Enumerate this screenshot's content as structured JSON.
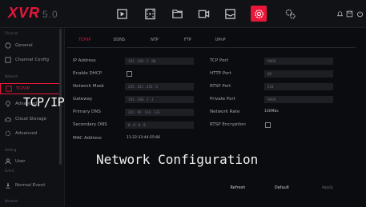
{
  "app": {
    "logo": "XVR",
    "version": "5.0"
  },
  "top_nav": [
    {
      "icon": "playback-icon",
      "active": false
    },
    {
      "icon": "film-icon",
      "active": false
    },
    {
      "icon": "folder-icon",
      "active": false
    },
    {
      "icon": "camera-icon",
      "active": false
    },
    {
      "icon": "storage-icon",
      "active": false
    },
    {
      "icon": "settings-gear-icon",
      "active": true
    },
    {
      "icon": "network-icon",
      "active": false
    }
  ],
  "top_right_icons": [
    "bell-icon",
    "save-icon",
    "power-icon"
  ],
  "sidebar": {
    "groups": {
      "channel": "Channel",
      "network": "Network",
      "setting": "Setting",
      "event": "Event",
      "system": "Network"
    },
    "items": [
      {
        "label": "General",
        "icon": "general-icon"
      },
      {
        "label": "Channel Config",
        "icon": "channel-icon"
      },
      {
        "label": "TCP/IP",
        "icon": "tcpip-icon"
      },
      {
        "label": "Advanced",
        "icon": "advanced-icon"
      },
      {
        "label": "Cloud Storage",
        "icon": "cloud-icon"
      },
      {
        "label": "Advanced",
        "icon": "advanced2-icon"
      },
      {
        "label": "User",
        "icon": "user-icon"
      },
      {
        "label": "Normal Event",
        "icon": "event-icon"
      }
    ]
  },
  "tabs": [
    "TCP/IP",
    "DDNS",
    "NTP",
    "FTP",
    "UPnP"
  ],
  "fields_left": [
    {
      "label": "IP Address",
      "value": "192 . 168 . 1 . 88"
    },
    {
      "label": "Enable DHCP",
      "value": ""
    },
    {
      "label": "Network Mask",
      "value": "255 . 255 . 255 . 0"
    },
    {
      "label": "Gateway",
      "value": "192 . 168 . 1 . 1"
    },
    {
      "label": "Primary DNS",
      "value": "202 . 96 . 134 . 133"
    },
    {
      "label": "Secondary DNS",
      "value": "8 . 8 . 8 . 8"
    },
    {
      "label": "MAC Address",
      "value": "11:22:33:44:55:66"
    }
  ],
  "fields_right": [
    {
      "label": "TCP Port",
      "value": "9000"
    },
    {
      "label": "HTTP Port",
      "value": "80"
    },
    {
      "label": "RTSP Port",
      "value": "554"
    },
    {
      "label": "Private Port",
      "value": "9000"
    },
    {
      "label": "Network Rate",
      "value": "100Mbs"
    },
    {
      "label": "RTSP Encryption",
      "value": ""
    }
  ],
  "buttons": {
    "refresh": "Refresh",
    "default": "Default",
    "apply": "Apply"
  },
  "overlays": {
    "left": "TCP/IP",
    "bottom": "Network Configuration"
  },
  "colors": {
    "accent": "#e8173a",
    "bg": "#0b0c0f"
  }
}
